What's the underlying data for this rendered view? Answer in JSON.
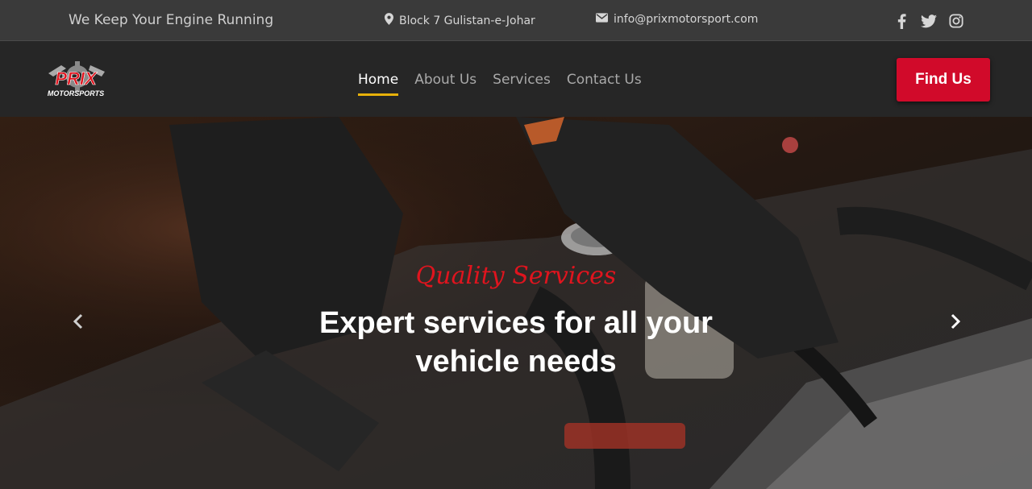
{
  "topbar": {
    "tagline": "We Keep Your Engine Running",
    "address": "Block 7 Gulistan-e-Johar",
    "email": "info@prixmotorsport.com",
    "social": [
      "facebook-icon",
      "twitter-icon",
      "instagram-icon"
    ]
  },
  "logo": {
    "line1": "PRIX",
    "line2": "MOTORSPORTS"
  },
  "nav": {
    "items": [
      "Home",
      "About Us",
      "Services",
      "Contact Us"
    ],
    "active": "Home",
    "cta_label": "Find Us"
  },
  "hero": {
    "subtitle": "Quality Services",
    "title": "Expert services for all your vehicle needs"
  },
  "colors": {
    "accent_red": "#d10a2a",
    "underline": "#e7b10a",
    "topbar": "#3a3a3a",
    "navbar": "#262626"
  }
}
